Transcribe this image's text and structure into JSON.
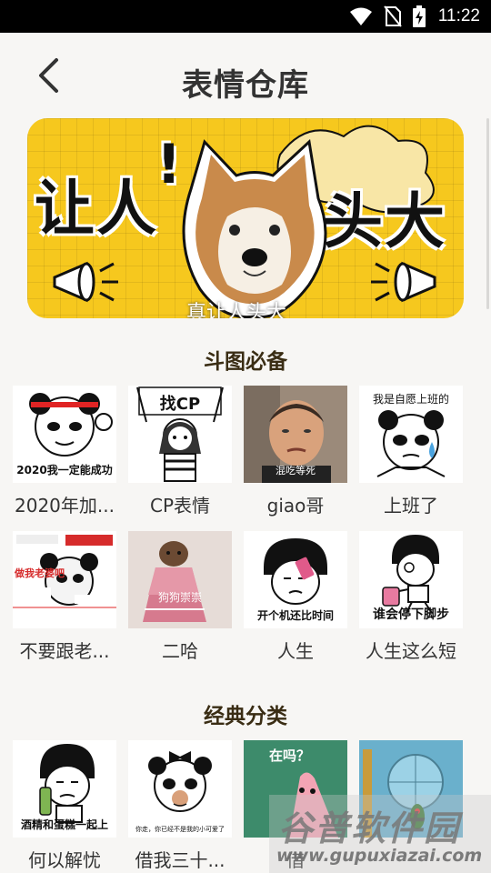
{
  "status_bar": {
    "time": "11:22",
    "icons": [
      "wifi-icon",
      "no-sim-icon",
      "battery-charging-icon"
    ]
  },
  "header": {
    "title": "表情仓库",
    "back_icon": "chevron-left-icon"
  },
  "banner": {
    "left_text": "让人",
    "exclaim": "!",
    "right_text": "头大",
    "caption": "真让人头大",
    "bg_color": "#f6c81e"
  },
  "sections": [
    {
      "title": "斗图必备",
      "items": [
        {
          "label": "2020年加...",
          "thumb_text": "2020我一定能成功",
          "icon": "panda-meme-icon"
        },
        {
          "label": "CP表情",
          "thumb_text": "找CP",
          "icon": "cartoon-girl-sign-icon"
        },
        {
          "label": "giao哥",
          "thumb_text": "混吃等死",
          "icon": "man-photo-icon"
        },
        {
          "label": "上班了",
          "thumb_text": "我是自愿上班的",
          "icon": "panda-crying-icon"
        },
        {
          "label": "不要跟老...",
          "thumb_text": "做我老婆吧",
          "icon": "panda-collage-icon"
        },
        {
          "label": "二哈",
          "thumb_text": "狗狗崇崇",
          "icon": "dog-dress-icon"
        },
        {
          "label": "人生",
          "thumb_text": "开个机还比时间",
          "icon": "mushroom-head-phone-icon"
        },
        {
          "label": "人生这么短",
          "thumb_text": "谁会停下脚步",
          "icon": "mushroom-head-walking-icon"
        }
      ]
    },
    {
      "title": "经典分类",
      "items": [
        {
          "label": "何以解忧",
          "thumb_text": "酒精和蛋糕一起上",
          "icon": "mushroom-head-bottle-icon"
        },
        {
          "label": "借我三十...",
          "thumb_text": "你走，你已经不是我的小可爱了",
          "icon": "panda-bow-icon"
        },
        {
          "label": "借",
          "thumb_text": "在吗？",
          "icon": "patrick-star-icon"
        },
        {
          "label": "",
          "thumb_text": "",
          "icon": "plankton-icon"
        }
      ]
    }
  ],
  "watermark": {
    "line1": "谷普软件园",
    "line2": "www.gupuxiazai.com"
  }
}
